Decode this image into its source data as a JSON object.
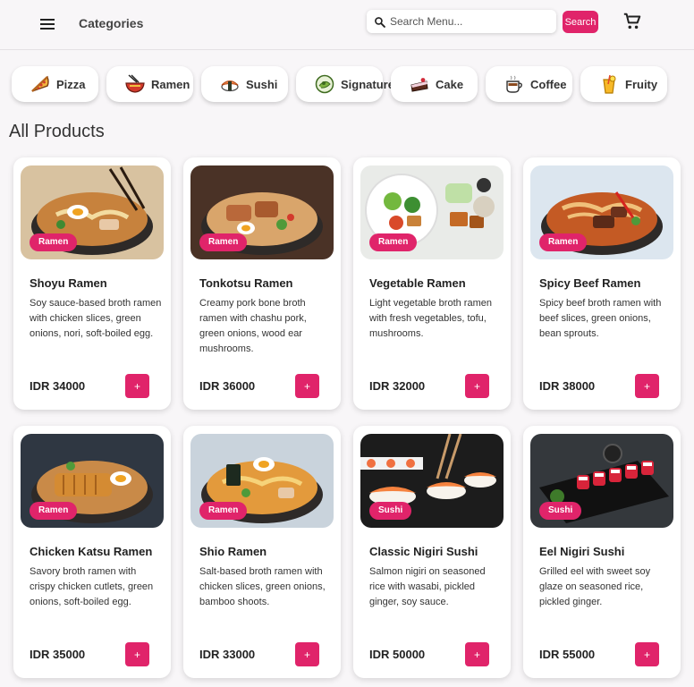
{
  "header": {
    "title": "Categories",
    "search_placeholder": "Search Menu...",
    "search_button": "Search"
  },
  "categories": [
    {
      "label": "Pizza",
      "icon": "pizza-icon"
    },
    {
      "label": "Ramen",
      "icon": "ramen-icon"
    },
    {
      "label": "Sushi",
      "icon": "sushi-icon"
    },
    {
      "label": "Signature",
      "icon": "signature-icon"
    },
    {
      "label": "Cake",
      "icon": "cake-icon"
    },
    {
      "label": "Coffee",
      "icon": "coffee-icon"
    },
    {
      "label": "Fruity",
      "icon": "fruity-icon"
    }
  ],
  "section_title": "All Products",
  "colors": {
    "accent": "#e0246a",
    "background": "#f8f6f8"
  },
  "products": [
    {
      "name": "Shoyu Ramen",
      "category": "Ramen",
      "description": "Soy sauce-based broth ramen with chicken slices, green onions, nori, soft-boiled egg.",
      "price": "IDR 34000",
      "add_label": "+"
    },
    {
      "name": "Tonkotsu Ramen",
      "category": "Ramen",
      "description": "Creamy pork bone broth ramen with chashu pork, green onions, wood ear mushrooms.",
      "price": "IDR 36000",
      "add_label": "+"
    },
    {
      "name": "Vegetable Ramen",
      "category": "Ramen",
      "description": "Light vegetable broth ramen with fresh vegetables, tofu, mushrooms.",
      "price": "IDR 32000",
      "add_label": "+"
    },
    {
      "name": "Spicy Beef Ramen",
      "category": "Ramen",
      "description": "Spicy beef broth ramen with beef slices, green onions, bean sprouts.",
      "price": "IDR 38000",
      "add_label": "+"
    },
    {
      "name": "Chicken Katsu Ramen",
      "category": "Ramen",
      "description": "Savory broth ramen with crispy chicken cutlets, green onions, soft-boiled egg.",
      "price": "IDR 35000",
      "add_label": "+"
    },
    {
      "name": "Shio Ramen",
      "category": "Ramen",
      "description": "Salt-based broth ramen with chicken slices, green onions, bamboo shoots.",
      "price": "IDR 33000",
      "add_label": "+"
    },
    {
      "name": "Classic Nigiri Sushi",
      "category": "Sushi",
      "description": "Salmon nigiri on seasoned rice with wasabi, pickled ginger, soy sauce.",
      "price": "IDR 50000",
      "add_label": "+"
    },
    {
      "name": "Eel Nigiri Sushi",
      "category": "Sushi",
      "description": "Grilled eel with sweet soy glaze on seasoned rice, pickled ginger.",
      "price": "IDR 55000",
      "add_label": "+"
    }
  ]
}
